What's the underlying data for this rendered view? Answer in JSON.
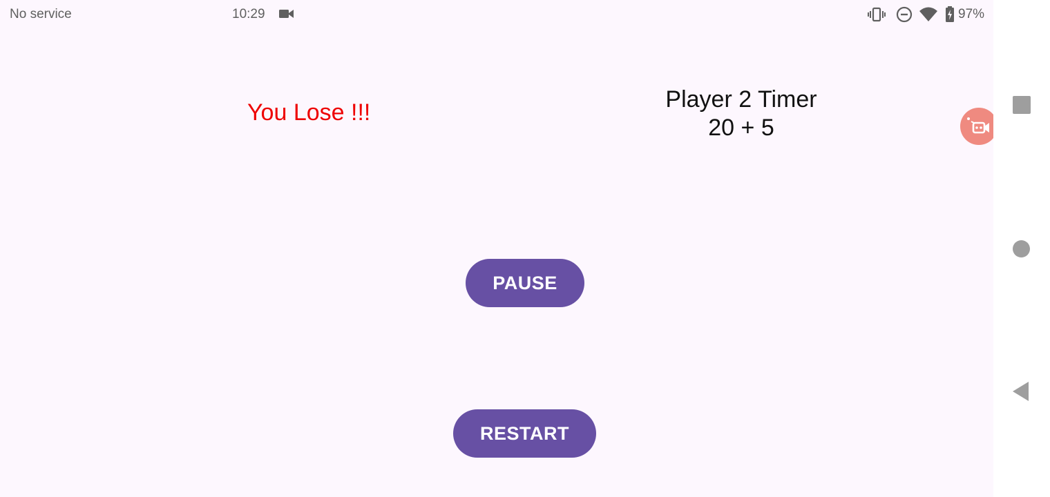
{
  "status_bar": {
    "carrier": "No service",
    "time": "10:29",
    "battery": "97%",
    "icons": [
      "video-camera-icon",
      "vibrate-icon",
      "do-not-disturb-icon",
      "wifi-icon",
      "battery-charging-icon"
    ]
  },
  "game": {
    "result_text": "You Lose !!!",
    "timer_title": "Player 2 Timer",
    "timer_value": "20 + 5",
    "result_color": "#ee0000"
  },
  "buttons": {
    "pause_label": "PAUSE",
    "restart_label": "RESTART",
    "color": "#6750a4"
  },
  "nav_bar": {
    "icons": [
      "recents-icon",
      "home-icon",
      "back-icon"
    ]
  },
  "floating": {
    "icon": "screen-recorder-icon",
    "color": "#ef8a80"
  }
}
